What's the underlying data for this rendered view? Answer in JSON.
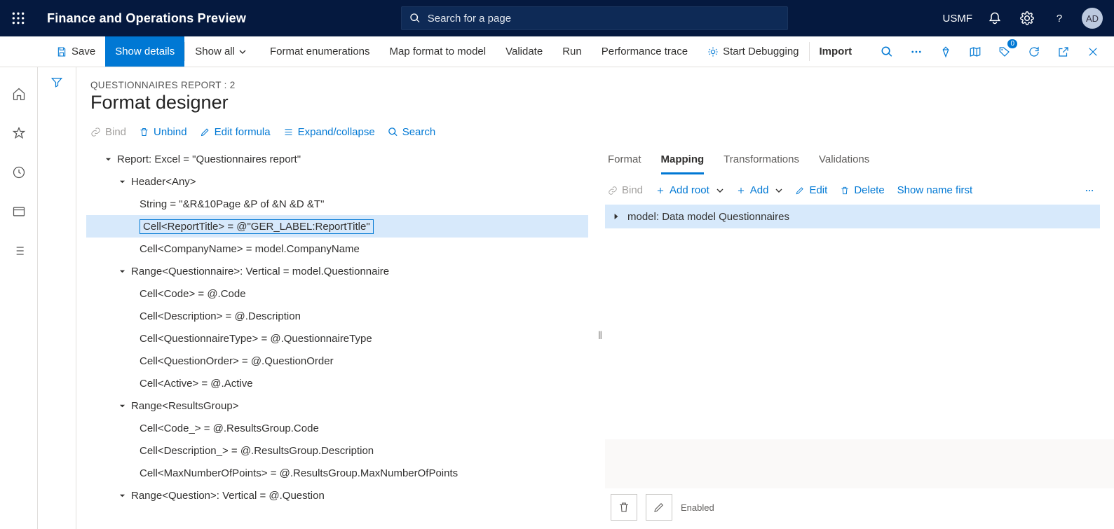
{
  "header": {
    "app_title": "Finance and Operations Preview",
    "search_placeholder": "Search for a page",
    "company": "USMF",
    "avatar": "AD"
  },
  "cmdbar": {
    "save": "Save",
    "show_details": "Show details",
    "show_all": "Show all",
    "format_enum": "Format enumerations",
    "map_format": "Map format to model",
    "validate": "Validate",
    "run": "Run",
    "perf_trace": "Performance trace",
    "start_debug": "Start Debugging",
    "import": "Import",
    "badge_count": "0"
  },
  "page": {
    "breadcrumb": "QUESTIONNAIRES REPORT : 2",
    "title": "Format designer"
  },
  "toolbar": {
    "bind": "Bind",
    "unbind": "Unbind",
    "edit_formula": "Edit formula",
    "expand_collapse": "Expand/collapse",
    "search": "Search"
  },
  "tree": [
    {
      "level": 0,
      "expander": "down",
      "text": "Report: Excel  =  \"Questionnaires report\""
    },
    {
      "level": 1,
      "expander": "down",
      "text": "Header<Any>"
    },
    {
      "level": 2,
      "expander": "",
      "text": "String  =  \"&R&10Page &P of &N &D &T\""
    },
    {
      "level": 2,
      "expander": "",
      "text": "Cell<ReportTitle>  =  @\"GER_LABEL:ReportTitle\"",
      "selected": true
    },
    {
      "level": 2,
      "expander": "",
      "text": "Cell<CompanyName>  =  model.CompanyName"
    },
    {
      "level": 1,
      "expander": "down",
      "text": "Range<Questionnaire>: Vertical  =  model.Questionnaire"
    },
    {
      "level": 2,
      "expander": "",
      "text": "Cell<Code>  =  @.Code"
    },
    {
      "level": 2,
      "expander": "",
      "text": "Cell<Description>  =  @.Description"
    },
    {
      "level": 2,
      "expander": "",
      "text": "Cell<QuestionnaireType>  =  @.QuestionnaireType"
    },
    {
      "level": 2,
      "expander": "",
      "text": "Cell<QuestionOrder>  =  @.QuestionOrder"
    },
    {
      "level": 2,
      "expander": "",
      "text": "Cell<Active>  =  @.Active"
    },
    {
      "level": 1,
      "expander": "down",
      "text": "Range<ResultsGroup>"
    },
    {
      "level": 2,
      "expander": "",
      "text": "Cell<Code_>  =  @.ResultsGroup.Code"
    },
    {
      "level": 2,
      "expander": "",
      "text": "Cell<Description_>  =  @.ResultsGroup.Description"
    },
    {
      "level": 2,
      "expander": "",
      "text": "Cell<MaxNumberOfPoints>  =  @.ResultsGroup.MaxNumberOfPoints"
    },
    {
      "level": 1,
      "expander": "down",
      "text": "Range<Question>: Vertical  =  @.Question"
    }
  ],
  "tabs": {
    "format": "Format",
    "mapping": "Mapping",
    "transformations": "Transformations",
    "validations": "Validations"
  },
  "rtoolbar": {
    "bind": "Bind",
    "add_root": "Add root",
    "add": "Add",
    "edit": "Edit",
    "delete": "Delete",
    "show_name_first": "Show name first"
  },
  "model_row": "model: Data model Questionnaires",
  "bottom": {
    "enabled": "Enabled"
  }
}
